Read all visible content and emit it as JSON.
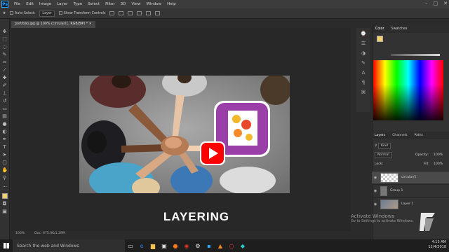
{
  "app": {
    "logo": "Ps",
    "menu": [
      "File",
      "Edit",
      "Image",
      "Layer",
      "Type",
      "Select",
      "Filter",
      "3D",
      "View",
      "Window",
      "Help"
    ]
  },
  "options": {
    "auto_select_label": "Auto-Select:",
    "auto_select_value": "Layer",
    "transform_label": "Show Transform Controls"
  },
  "document": {
    "tab_title": "portfolio.jpg @ 100% (circular/1, RGB/8#) *",
    "status_zoom": "100%",
    "status_doc": "Doc: 675.0K/1.29M"
  },
  "caption": "LAYERING",
  "panels": {
    "color_tabs": [
      "Color",
      "Swatches"
    ],
    "layer_tabs": [
      "Layers",
      "Channels",
      "Paths"
    ],
    "kind_label": "Kind",
    "blend_mode": "Normal",
    "opacity_label": "Opacity:",
    "opacity_value": "100%",
    "lock_label": "Lock:",
    "fill_label": "Fill:",
    "fill_value": "100%",
    "layers": [
      {
        "name": "circular/1",
        "selected": true
      },
      {
        "name": "Group 1",
        "selected": false
      },
      {
        "name": "Layer 1",
        "selected": false
      }
    ]
  },
  "watermark": {
    "title": "Activate Windows",
    "subtitle": "Go to Settings to activate Windows."
  },
  "taskbar": {
    "search_placeholder": "Search the web and Windows",
    "time": "4:13 AM",
    "date": "12/4/2018"
  },
  "colors": {
    "accent_ps": "#31a8ff",
    "foreground_swatch": "#f2d06b",
    "youtube_red": "#ff0000",
    "app_icon_purple": "#9b3fa8"
  }
}
